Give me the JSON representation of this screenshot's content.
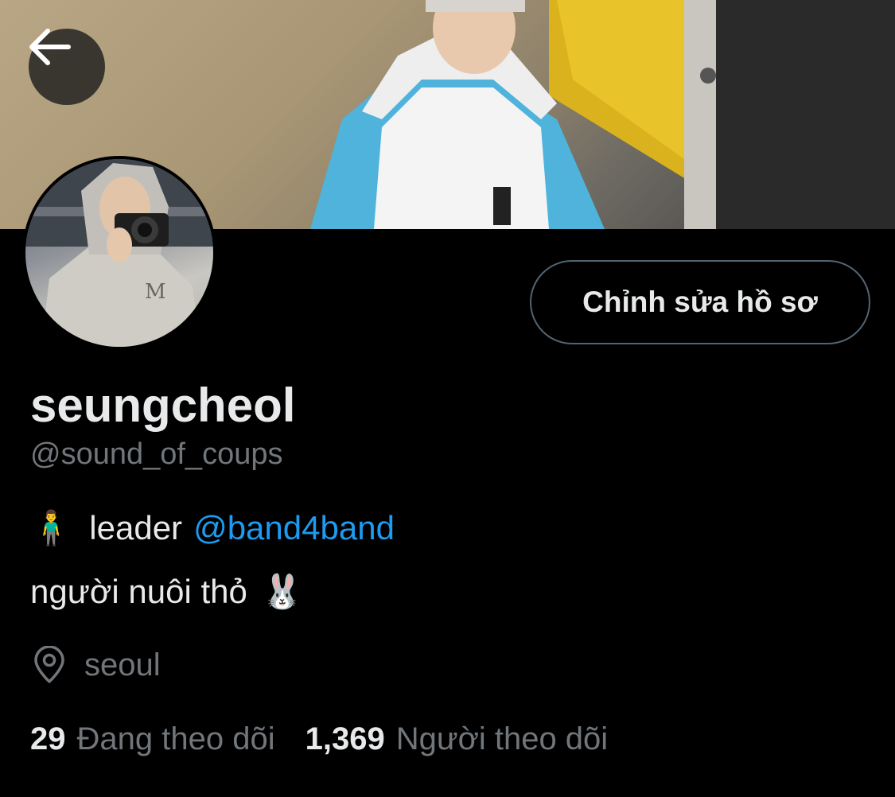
{
  "header": {
    "back_icon": "arrow-left-icon"
  },
  "profile": {
    "edit_button_label": "Chỉnh sửa hồ sơ",
    "display_name": "seungcheol",
    "handle": "@sound_of_coups",
    "bio": {
      "line1_emoji": "🧍‍♂️",
      "line1_text": "leader",
      "line1_mention": "@band4band",
      "line2_text": "người nuôi thỏ",
      "line2_emoji": "🐰"
    },
    "location_icon": "location-pin-icon",
    "location": "seoul",
    "stats": {
      "following_count": "29",
      "following_label": "Đang theo dõi",
      "followers_count": "1,369",
      "followers_label": "Người theo dõi"
    }
  },
  "colors": {
    "background": "#000000",
    "text_primary": "#e7e9ea",
    "text_secondary": "#71767b",
    "accent_link": "#1d9bf0",
    "button_border": "#536471"
  }
}
